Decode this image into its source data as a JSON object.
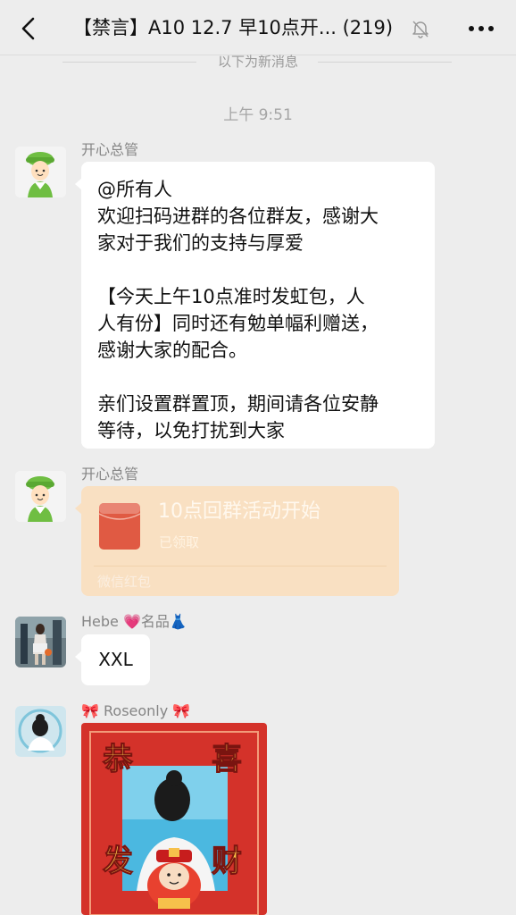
{
  "nav": {
    "title": "【禁言】A10 12.7 早10点开... (219)",
    "back_icon": "back-arrow-icon",
    "mute_icon": "bell-muted-icon",
    "more_icon": "more-icon"
  },
  "divider": {
    "text": "以下为新消息"
  },
  "timestamp": "上午 9:51",
  "messages": [
    {
      "sender": "开心总管",
      "avatar": "green-hat-avatar",
      "lines": [
        "@所有人",
        "欢迎扫码进群的各位群友，感谢大",
        "家对于我们的支持与厚爱",
        "",
        "【今天上午10点准时发虹包，人",
        "人有份】同时还有勉单幅利赠送，",
        "感谢大家的配合。",
        "",
        "亲们设置群置顶，期间请各位安静",
        "等待，以免打扰到大家"
      ]
    },
    {
      "sender": "开心总管",
      "avatar": "green-hat-avatar",
      "red_packet": {
        "title": "10点回群活动开始",
        "status": "已领取",
        "footer": "微信红包"
      }
    },
    {
      "sender": "Hebe 💗名品👗",
      "avatar": "photo-avatar",
      "text": "XXL"
    },
    {
      "sender": "🎀 Roseonly 🎀",
      "avatar": "girl-photo-avatar",
      "image": {
        "char_tl": "恭",
        "char_tr": "喜",
        "char_bl": "发",
        "char_br": "财"
      }
    }
  ],
  "colors": {
    "background": "#ededed",
    "bubble": "#ffffff",
    "red_packet": "#f9e0c2",
    "envelope": "#e05a43",
    "image_frame": "#d4322a"
  }
}
